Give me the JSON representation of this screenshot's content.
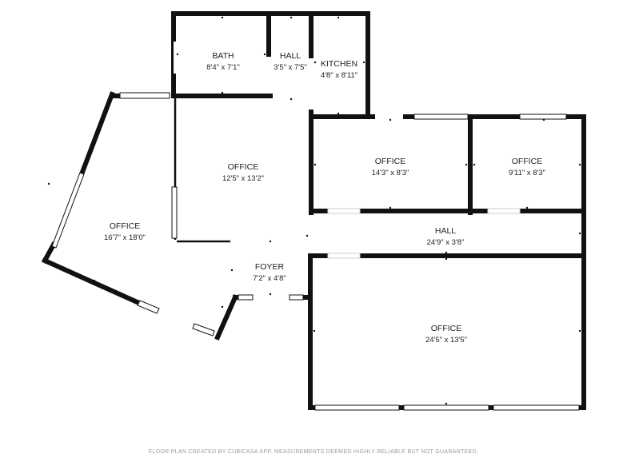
{
  "rooms": {
    "bath": {
      "name": "BATH",
      "dims": "8'4\" x 7'1\""
    },
    "hall_top": {
      "name": "HALL",
      "dims": "3'5\" x 7'5\""
    },
    "kitchen": {
      "name": "KITCHEN",
      "dims": "4'8\" x 8'11\""
    },
    "office_center": {
      "name": "OFFICE",
      "dims": "12'5\" x 13'2\""
    },
    "office_mid": {
      "name": "OFFICE",
      "dims": "14'3\" x 8'3\""
    },
    "office_right": {
      "name": "OFFICE",
      "dims": "9'11\" x 8'3\""
    },
    "office_left": {
      "name": "OFFICE",
      "dims": "16'7\" x 18'0\""
    },
    "hall_main": {
      "name": "HALL",
      "dims": "24'9\" x 3'8\""
    },
    "foyer": {
      "name": "FOYER",
      "dims": "7'2\" x 4'8\""
    },
    "office_large": {
      "name": "OFFICE",
      "dims": "24'5\" x 13'5\""
    }
  },
  "footer": "FLOOR PLAN CREATED BY CUBICASA APP. MEASUREMENTS DEEMED HIGHLY RELIABLE BUT NOT GUARANTEED."
}
